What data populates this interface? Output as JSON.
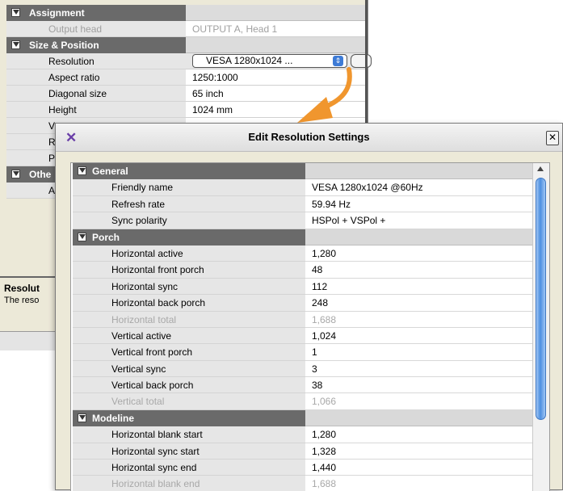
{
  "background_panel": {
    "categories": [
      {
        "label": "Assignment",
        "rows": [
          {
            "label": "Output head",
            "value": "OUTPUT A, Head 1",
            "dim": true
          }
        ]
      },
      {
        "label": "Size & Position",
        "rows": [
          {
            "label": "Resolution",
            "value": "VESA 1280x1024 ...",
            "dim": false
          },
          {
            "label": "Aspect ratio",
            "value": "1250:1000",
            "dim": false
          },
          {
            "label": "Diagonal size",
            "value": "65 inch",
            "dim": false
          },
          {
            "label": "Height",
            "value": "1024 mm",
            "dim": false
          },
          {
            "label": "V",
            "value": "",
            "dim": false
          },
          {
            "label": "R",
            "value": "",
            "dim": false
          },
          {
            "label": "P",
            "value": "",
            "dim": false
          }
        ]
      },
      {
        "label": "Othe",
        "rows": [
          {
            "label": "A",
            "value": "",
            "dim": false
          }
        ]
      }
    ],
    "description_title": "Resolut",
    "description_text": "The reso"
  },
  "dialog": {
    "title": "Edit Resolution Settings",
    "close_glyph": "✕",
    "app_icon_glyph": "✕",
    "categories": [
      {
        "label": "General",
        "rows": [
          {
            "label": "Friendly name",
            "value": "VESA 1280x1024 @60Hz",
            "dim": false
          },
          {
            "label": "Refresh rate",
            "value": "59.94 Hz",
            "dim": false
          },
          {
            "label": "Sync polarity",
            "value": "HSPol +  VSPol +",
            "dim": false
          }
        ]
      },
      {
        "label": "Porch",
        "rows": [
          {
            "label": "Horizontal active",
            "value": "1,280",
            "dim": false
          },
          {
            "label": "Horizontal front porch",
            "value": "48",
            "dim": false
          },
          {
            "label": "Horizontal sync",
            "value": "112",
            "dim": false
          },
          {
            "label": "Horizontal back porch",
            "value": "248",
            "dim": false
          },
          {
            "label": "Horizontal total",
            "value": "1,688",
            "dim": true
          },
          {
            "label": "Vertical active",
            "value": "1,024",
            "dim": false
          },
          {
            "label": "Vertical front porch",
            "value": "1",
            "dim": false
          },
          {
            "label": "Vertical sync",
            "value": "3",
            "dim": false
          },
          {
            "label": "Vertical back porch",
            "value": "38",
            "dim": false
          },
          {
            "label": "Vertical total",
            "value": "1,066",
            "dim": true
          }
        ]
      },
      {
        "label": "Modeline",
        "rows": [
          {
            "label": "Horizontal blank start",
            "value": "1,280",
            "dim": false
          },
          {
            "label": "Horizontal sync start",
            "value": "1,328",
            "dim": false
          },
          {
            "label": "Horizontal sync end",
            "value": "1,440",
            "dim": false
          },
          {
            "label": "Horizontal blank end",
            "value": "1,688",
            "dim": true
          }
        ]
      }
    ]
  },
  "colors": {
    "category_bg": "#6a6a6a",
    "arrow": "#f0962e",
    "scroll_thumb": "#4d8fe0"
  }
}
